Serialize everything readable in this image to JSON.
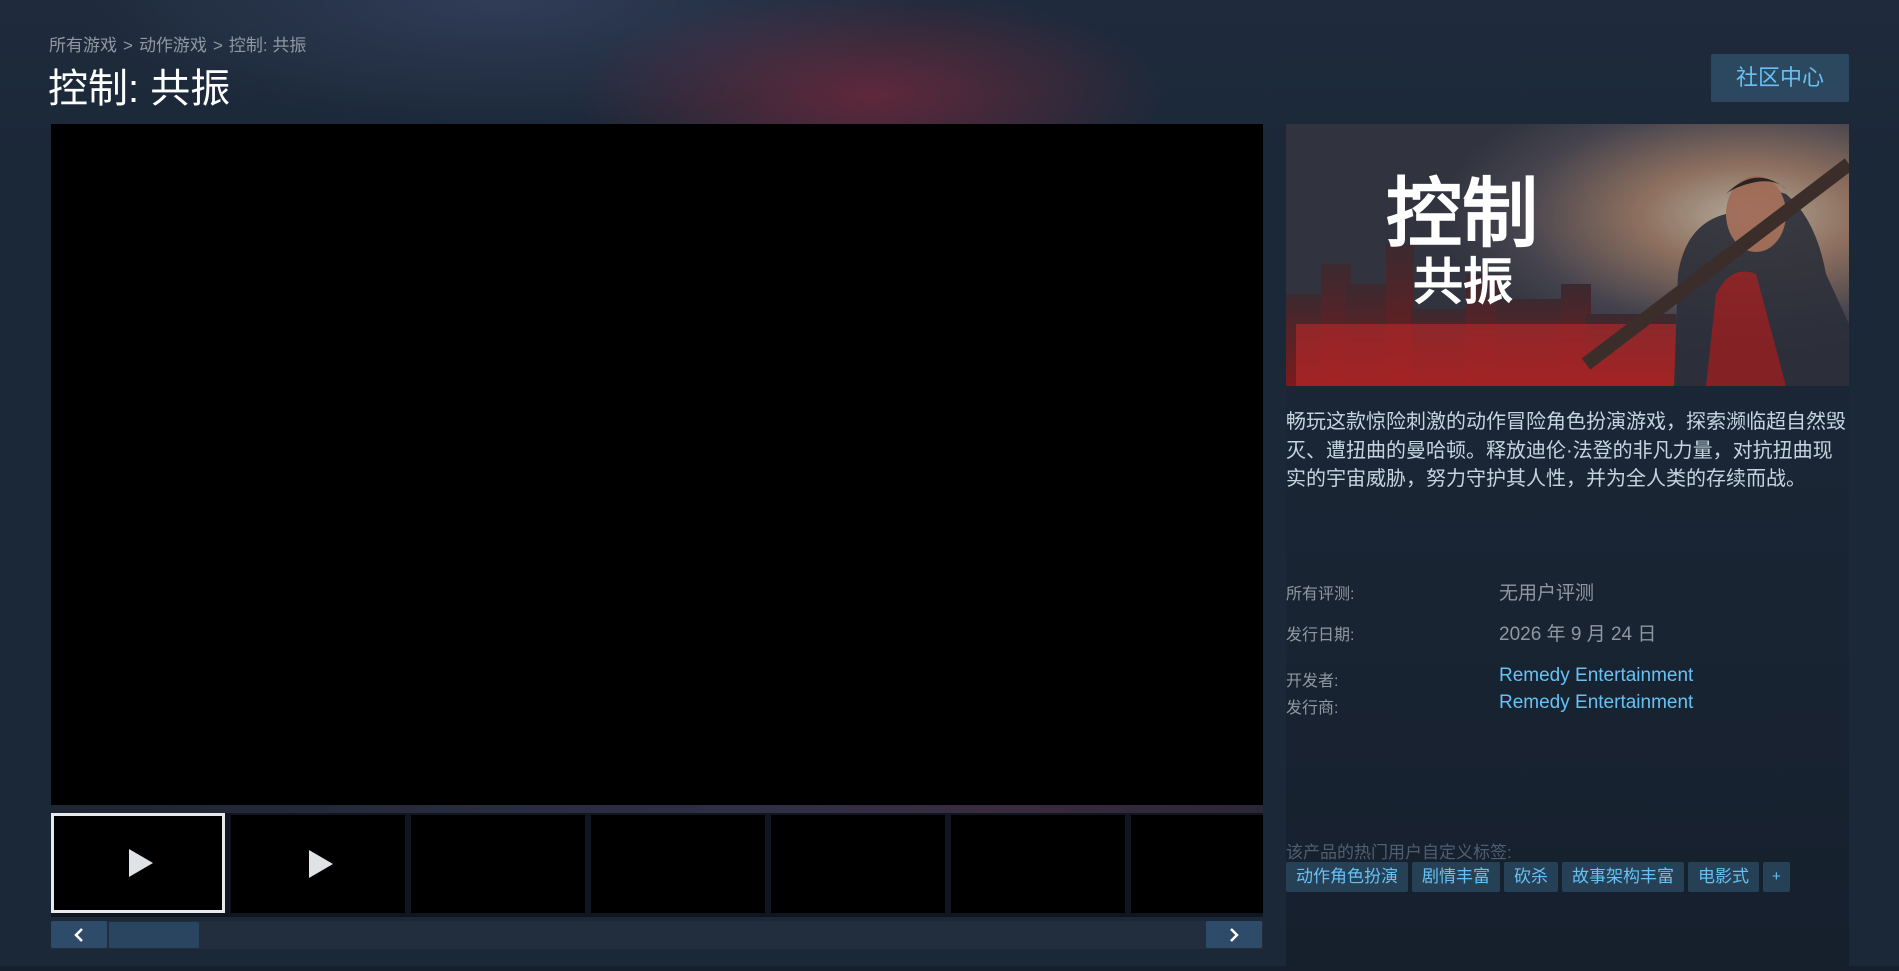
{
  "breadcrumb": [
    {
      "label": "所有游戏"
    },
    {
      "label": "动作游戏"
    },
    {
      "label": "控制: 共振"
    }
  ],
  "breadcrumb_separator": ">",
  "page_title": "控制: 共振",
  "community_button": "社区中心",
  "media": {
    "thumbnails": [
      {
        "kind": "video",
        "selected": true
      },
      {
        "kind": "video",
        "selected": false
      },
      {
        "kind": "screenshot",
        "selected": false
      },
      {
        "kind": "screenshot",
        "selected": false
      },
      {
        "kind": "screenshot",
        "selected": false
      },
      {
        "kind": "screenshot",
        "selected": false
      },
      {
        "kind": "screenshot",
        "selected": false
      }
    ],
    "prev_icon": "chevron-left-icon",
    "next_icon": "chevron-right-icon"
  },
  "capsule": {
    "title_line1": "控制",
    "title_line2": "共振"
  },
  "description": "畅玩这款惊险刺激的动作冒险角色扮演游戏，探索濒临超自然毁灭、遭扭曲的曼哈顿。释放迪伦·法登的非凡力量，对抗扭曲现实的宇宙威胁，努力守护其人性，并为全人类的存续而战。",
  "info": {
    "reviews_label": "所有评测:",
    "reviews_value": "无用户评测",
    "release_label": "发行日期:",
    "release_value": "2026 年 9 月 24 日",
    "developer_label": "开发者:",
    "developer_value": "Remedy Entertainment",
    "publisher_label": "发行商:",
    "publisher_value": "Remedy Entertainment"
  },
  "tags": {
    "heading": "该产品的热门用户自定义标签:",
    "items": [
      "动作角色扮演",
      "剧情丰富",
      "砍杀",
      "故事架构丰富",
      "电影式"
    ],
    "more": "+"
  },
  "colors": {
    "background": "#1b2838",
    "link": "#67c1f5",
    "button_bg": "#2a475e",
    "muted_text": "#8f98a0"
  }
}
